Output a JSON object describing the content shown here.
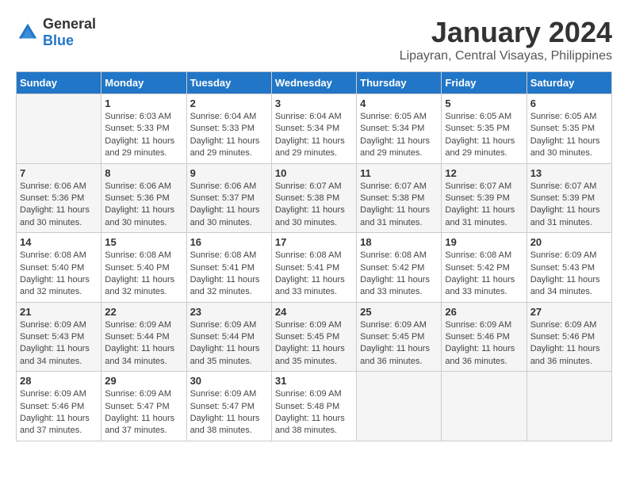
{
  "logo": {
    "general": "General",
    "blue": "Blue"
  },
  "header": {
    "title": "January 2024",
    "subtitle": "Lipayran, Central Visayas, Philippines"
  },
  "days_of_week": [
    "Sunday",
    "Monday",
    "Tuesday",
    "Wednesday",
    "Thursday",
    "Friday",
    "Saturday"
  ],
  "weeks": [
    [
      {
        "day": "",
        "info": ""
      },
      {
        "day": "1",
        "info": "Sunrise: 6:03 AM\nSunset: 5:33 PM\nDaylight: 11 hours\nand 29 minutes."
      },
      {
        "day": "2",
        "info": "Sunrise: 6:04 AM\nSunset: 5:33 PM\nDaylight: 11 hours\nand 29 minutes."
      },
      {
        "day": "3",
        "info": "Sunrise: 6:04 AM\nSunset: 5:34 PM\nDaylight: 11 hours\nand 29 minutes."
      },
      {
        "day": "4",
        "info": "Sunrise: 6:05 AM\nSunset: 5:34 PM\nDaylight: 11 hours\nand 29 minutes."
      },
      {
        "day": "5",
        "info": "Sunrise: 6:05 AM\nSunset: 5:35 PM\nDaylight: 11 hours\nand 29 minutes."
      },
      {
        "day": "6",
        "info": "Sunrise: 6:05 AM\nSunset: 5:35 PM\nDaylight: 11 hours\nand 30 minutes."
      }
    ],
    [
      {
        "day": "7",
        "info": "Sunrise: 6:06 AM\nSunset: 5:36 PM\nDaylight: 11 hours\nand 30 minutes."
      },
      {
        "day": "8",
        "info": "Sunrise: 6:06 AM\nSunset: 5:36 PM\nDaylight: 11 hours\nand 30 minutes."
      },
      {
        "day": "9",
        "info": "Sunrise: 6:06 AM\nSunset: 5:37 PM\nDaylight: 11 hours\nand 30 minutes."
      },
      {
        "day": "10",
        "info": "Sunrise: 6:07 AM\nSunset: 5:38 PM\nDaylight: 11 hours\nand 30 minutes."
      },
      {
        "day": "11",
        "info": "Sunrise: 6:07 AM\nSunset: 5:38 PM\nDaylight: 11 hours\nand 31 minutes."
      },
      {
        "day": "12",
        "info": "Sunrise: 6:07 AM\nSunset: 5:39 PM\nDaylight: 11 hours\nand 31 minutes."
      },
      {
        "day": "13",
        "info": "Sunrise: 6:07 AM\nSunset: 5:39 PM\nDaylight: 11 hours\nand 31 minutes."
      }
    ],
    [
      {
        "day": "14",
        "info": "Sunrise: 6:08 AM\nSunset: 5:40 PM\nDaylight: 11 hours\nand 32 minutes."
      },
      {
        "day": "15",
        "info": "Sunrise: 6:08 AM\nSunset: 5:40 PM\nDaylight: 11 hours\nand 32 minutes."
      },
      {
        "day": "16",
        "info": "Sunrise: 6:08 AM\nSunset: 5:41 PM\nDaylight: 11 hours\nand 32 minutes."
      },
      {
        "day": "17",
        "info": "Sunrise: 6:08 AM\nSunset: 5:41 PM\nDaylight: 11 hours\nand 33 minutes."
      },
      {
        "day": "18",
        "info": "Sunrise: 6:08 AM\nSunset: 5:42 PM\nDaylight: 11 hours\nand 33 minutes."
      },
      {
        "day": "19",
        "info": "Sunrise: 6:08 AM\nSunset: 5:42 PM\nDaylight: 11 hours\nand 33 minutes."
      },
      {
        "day": "20",
        "info": "Sunrise: 6:09 AM\nSunset: 5:43 PM\nDaylight: 11 hours\nand 34 minutes."
      }
    ],
    [
      {
        "day": "21",
        "info": "Sunrise: 6:09 AM\nSunset: 5:43 PM\nDaylight: 11 hours\nand 34 minutes."
      },
      {
        "day": "22",
        "info": "Sunrise: 6:09 AM\nSunset: 5:44 PM\nDaylight: 11 hours\nand 34 minutes."
      },
      {
        "day": "23",
        "info": "Sunrise: 6:09 AM\nSunset: 5:44 PM\nDaylight: 11 hours\nand 35 minutes."
      },
      {
        "day": "24",
        "info": "Sunrise: 6:09 AM\nSunset: 5:45 PM\nDaylight: 11 hours\nand 35 minutes."
      },
      {
        "day": "25",
        "info": "Sunrise: 6:09 AM\nSunset: 5:45 PM\nDaylight: 11 hours\nand 36 minutes."
      },
      {
        "day": "26",
        "info": "Sunrise: 6:09 AM\nSunset: 5:46 PM\nDaylight: 11 hours\nand 36 minutes."
      },
      {
        "day": "27",
        "info": "Sunrise: 6:09 AM\nSunset: 5:46 PM\nDaylight: 11 hours\nand 36 minutes."
      }
    ],
    [
      {
        "day": "28",
        "info": "Sunrise: 6:09 AM\nSunset: 5:46 PM\nDaylight: 11 hours\nand 37 minutes."
      },
      {
        "day": "29",
        "info": "Sunrise: 6:09 AM\nSunset: 5:47 PM\nDaylight: 11 hours\nand 37 minutes."
      },
      {
        "day": "30",
        "info": "Sunrise: 6:09 AM\nSunset: 5:47 PM\nDaylight: 11 hours\nand 38 minutes."
      },
      {
        "day": "31",
        "info": "Sunrise: 6:09 AM\nSunset: 5:48 PM\nDaylight: 11 hours\nand 38 minutes."
      },
      {
        "day": "",
        "info": ""
      },
      {
        "day": "",
        "info": ""
      },
      {
        "day": "",
        "info": ""
      }
    ]
  ]
}
